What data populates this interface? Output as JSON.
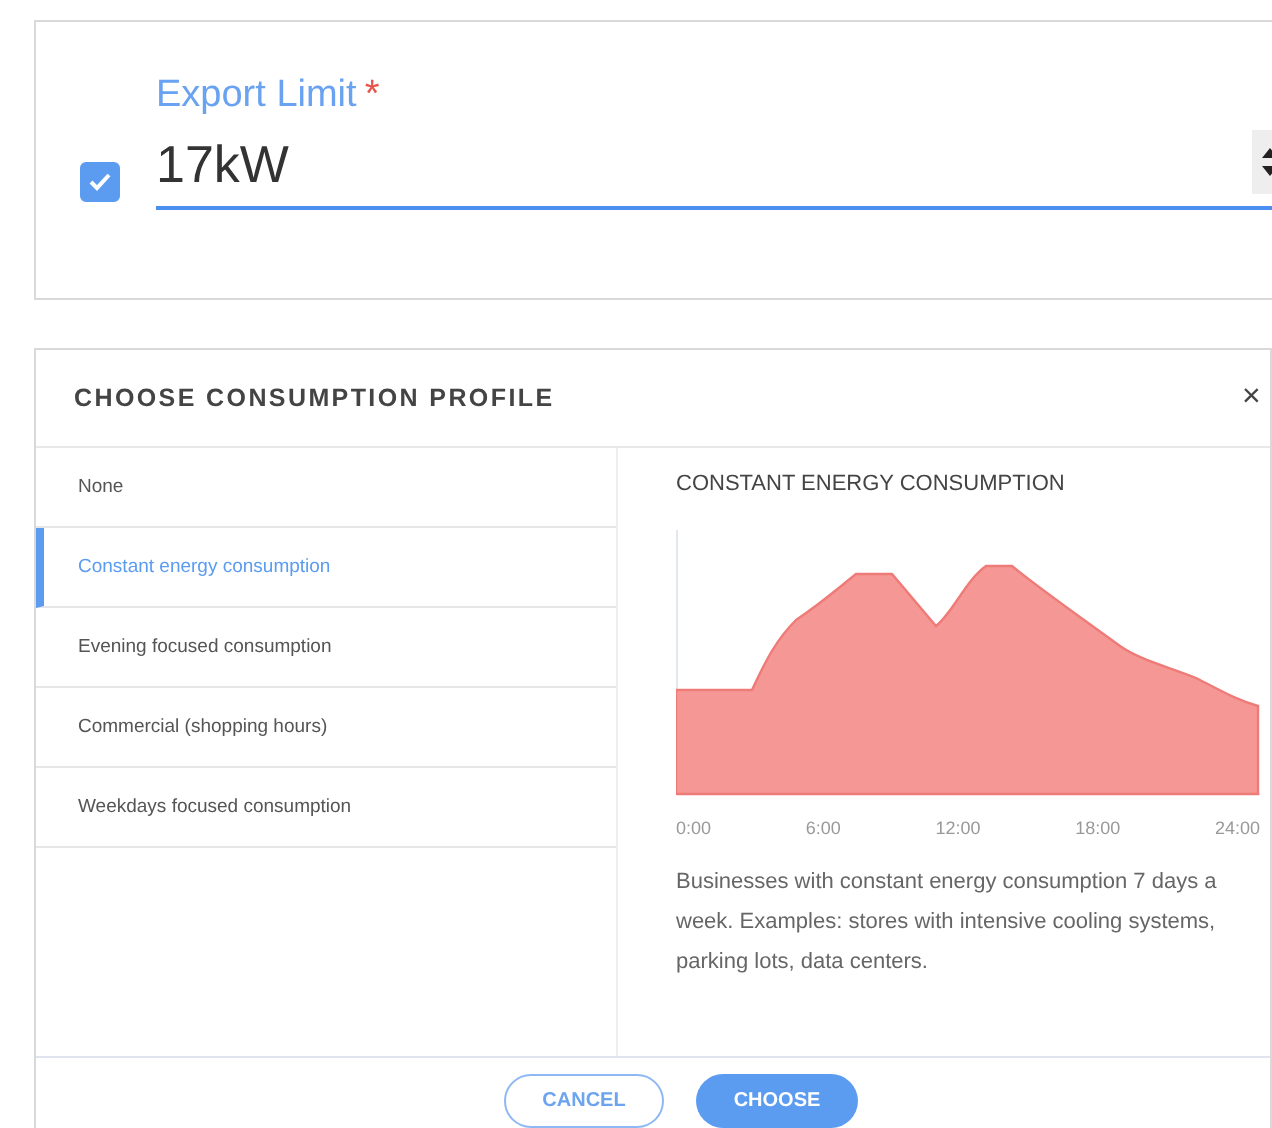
{
  "export_limit": {
    "label": "Export Limit",
    "required_mark": "*",
    "value": "17kW",
    "checked": true
  },
  "dialog": {
    "title": "CHOOSE CONSUMPTION PROFILE",
    "close": "×",
    "profiles": [
      {
        "label": "None",
        "selected": false
      },
      {
        "label": "Constant energy consumption",
        "selected": true
      },
      {
        "label": "Evening focused consumption",
        "selected": false
      },
      {
        "label": "Commercial (shopping hours)",
        "selected": false
      },
      {
        "label": "Weekdays focused consumption",
        "selected": false
      }
    ],
    "detail": {
      "title": "CONSTANT ENERGY CONSUMPTION",
      "x_labels": [
        "0:00",
        "6:00",
        "12:00",
        "18:00",
        "24:00"
      ],
      "description": "Businesses with constant energy consumption 7 days a week. Examples: stores with intensive cooling systems, parking lots, data centers."
    },
    "buttons": [
      {
        "label": "CANCEL",
        "kind": "secondary"
      },
      {
        "label": "CHOOSE",
        "kind": "primary"
      }
    ]
  }
}
